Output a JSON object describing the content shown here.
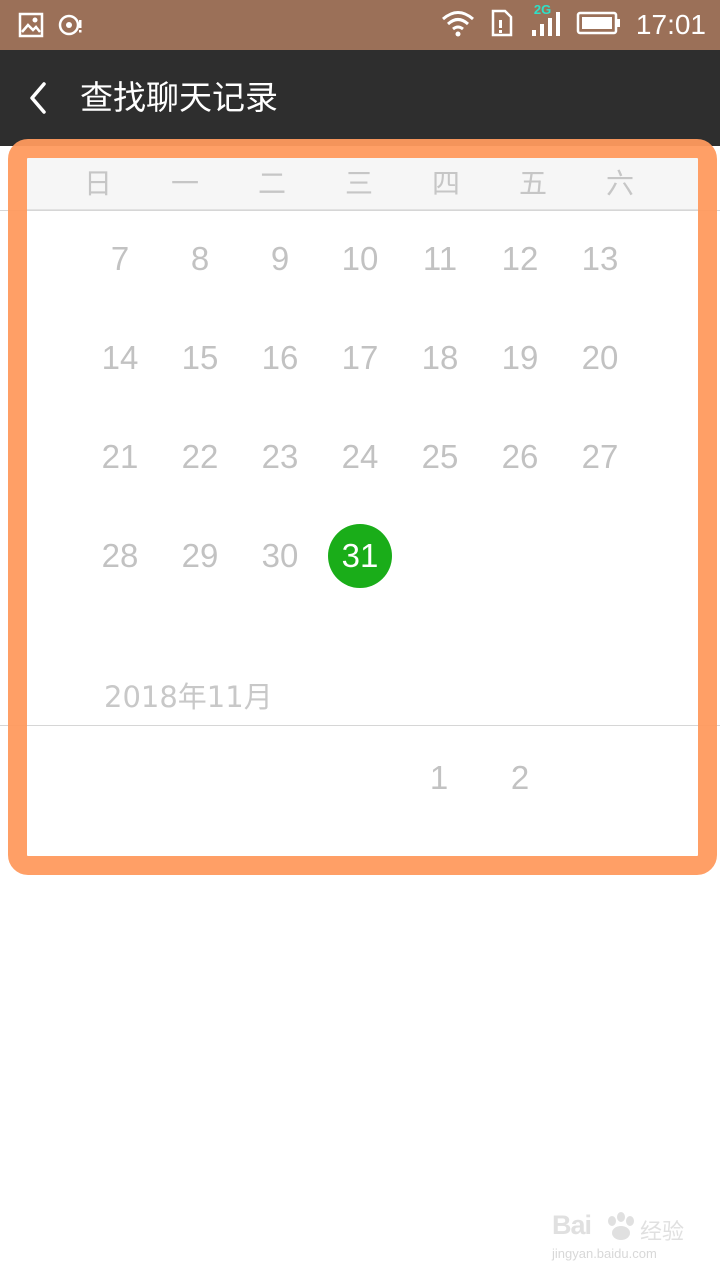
{
  "status_bar": {
    "time": "17:01",
    "network_label": "2G",
    "icons": [
      "image-icon",
      "media-icon",
      "wifi-icon",
      "sim-alert-icon",
      "signal-icon",
      "battery-icon"
    ]
  },
  "header": {
    "title": "查找聊天记录",
    "back_icon": "back-arrow-icon"
  },
  "calendar": {
    "weekdays": [
      "日",
      "一",
      "二",
      "三",
      "四",
      "五",
      "六"
    ],
    "weeks": [
      [
        "7",
        "8",
        "9",
        "10",
        "11",
        "12",
        "13"
      ],
      [
        "14",
        "15",
        "16",
        "17",
        "18",
        "19",
        "20"
      ],
      [
        "21",
        "22",
        "23",
        "24",
        "25",
        "26",
        "27"
      ],
      [
        "28",
        "29",
        "30",
        "31"
      ]
    ],
    "selected_day": "31",
    "selected_color": "#1aad19",
    "next_month_label": "2018年11月",
    "next_month_days": [
      "1",
      "2"
    ]
  },
  "highlight_color": "#ff9a5e",
  "watermark": {
    "brand": "Bai",
    "brand_cn": "经验",
    "url": "jingyan.baidu.com"
  }
}
